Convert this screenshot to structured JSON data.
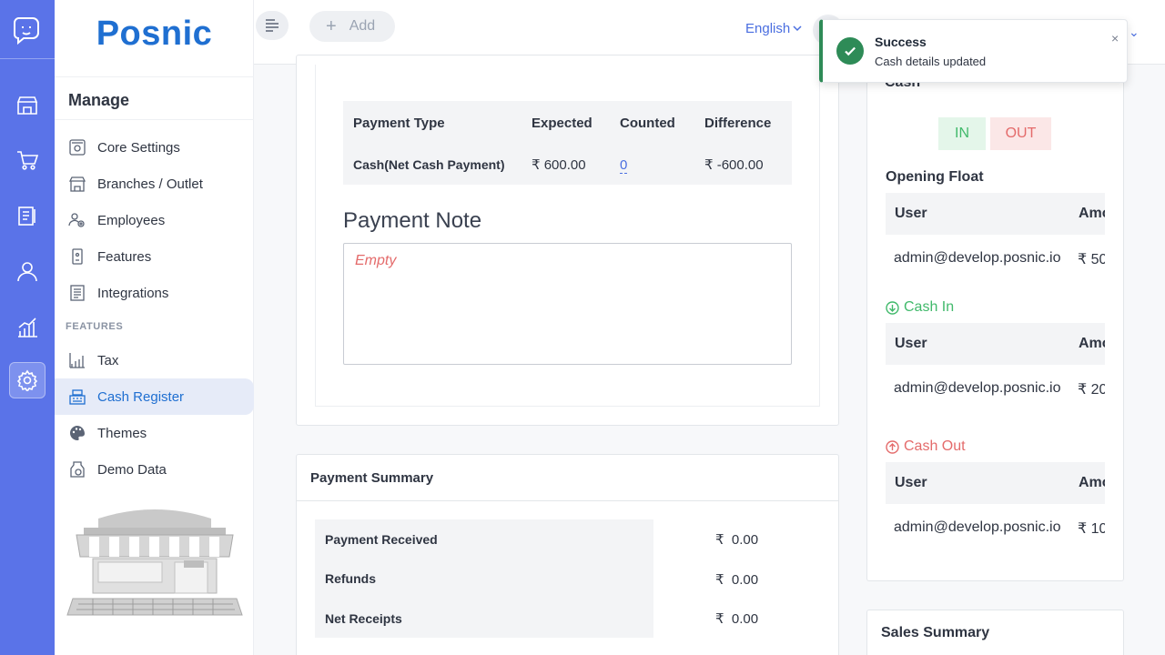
{
  "brand": {
    "name": "Posnic"
  },
  "colors": {
    "rail": "#5a73e8",
    "accent": "#1f6fd1",
    "green": "#41b96b",
    "red": "#e46b6b"
  },
  "rail_icons": [
    "posnic-logo-icon",
    "store-icon",
    "cart-icon",
    "clipboard-icon",
    "user-icon",
    "analytics-icon",
    "settings-icon"
  ],
  "nav": {
    "section_title": "Manage",
    "items": [
      {
        "label": "Core Settings",
        "icon": "core-settings-icon"
      },
      {
        "label": "Branches / Outlet",
        "icon": "branches-icon"
      },
      {
        "label": "Employees",
        "icon": "employees-icon"
      },
      {
        "label": "Features",
        "icon": "features-icon"
      },
      {
        "label": "Integrations",
        "icon": "integrations-icon"
      }
    ],
    "features_heading": "FEATURES",
    "feature_items": [
      {
        "label": "Tax",
        "icon": "tax-icon"
      },
      {
        "label": "Cash Register",
        "icon": "cash-register-icon",
        "active": true
      },
      {
        "label": "Themes",
        "icon": "palette-icon"
      },
      {
        "label": "Demo Data",
        "icon": "demo-data-icon"
      }
    ]
  },
  "topbar": {
    "add_label": "Add",
    "language": "English"
  },
  "payment_table": {
    "headers": [
      "Payment Type",
      "Expected",
      "Counted",
      "Difference"
    ],
    "rows": [
      {
        "type": "Cash(Net Cash Payment)",
        "expected": "₹ 600.00",
        "counted": "0",
        "difference": "₹ -600.00"
      }
    ]
  },
  "payment_note": {
    "title": "Payment Note",
    "placeholder": "Empty"
  },
  "payment_summary": {
    "title": "Payment Summary",
    "rows": [
      {
        "label": "Payment Received",
        "currency": "₹",
        "value": "0.00"
      },
      {
        "label": "Refunds",
        "currency": "₹",
        "value": "0.00"
      },
      {
        "label": "Net Receipts",
        "currency": "₹",
        "value": "0.00"
      }
    ]
  },
  "cash_panel": {
    "title": "Cash",
    "in_label": "IN",
    "out_label": "OUT",
    "opening_float": {
      "title": "Opening Float",
      "user_header": "User",
      "amount_header": "Amount",
      "user": "admin@develop.posnic.io",
      "amount": "₹ 50"
    },
    "cash_in": {
      "title": "Cash In",
      "user_header": "User",
      "amount_header": "Amount",
      "user": "admin@develop.posnic.io",
      "amount": "₹ 20"
    },
    "cash_out": {
      "title": "Cash Out",
      "user_header": "User",
      "amount_header": "Amount",
      "user": "admin@develop.posnic.io",
      "amount": "₹ 10"
    }
  },
  "sales_summary": {
    "title": "Sales Summary"
  },
  "toast": {
    "title": "Success",
    "message": "Cash details updated",
    "close": "×"
  }
}
